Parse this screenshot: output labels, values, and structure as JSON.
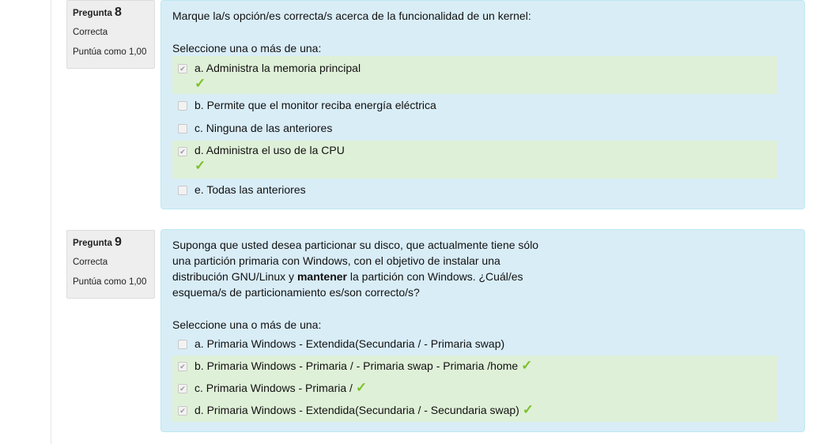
{
  "questions": [
    {
      "label": "Pregunta",
      "number": "8",
      "status": "Correcta",
      "grade": "Puntúa como 1,00",
      "text": "Marque la/s opción/es correcta/s acerca de la funcionalidad de un kernel:",
      "prompt": "Seleccione una o más de una:",
      "options": [
        {
          "text": "a. Administra la memoria principal",
          "checked": true,
          "correct": true
        },
        {
          "text": "b. Permite que el monitor reciba energía eléctrica",
          "checked": false
        },
        {
          "text": "c. Ninguna de las anteriores",
          "checked": false
        },
        {
          "text": "d. Administra el uso de la CPU",
          "checked": true,
          "correct": true
        },
        {
          "text": "e. Todas las anteriores",
          "checked": false
        }
      ]
    },
    {
      "label": "Pregunta",
      "number": "9",
      "status": "Correcta",
      "grade": "Puntúa como 1,00",
      "text_lines": [
        "Suponga que usted desea particionar su disco, que actualmente tiene sólo",
        "una partición primaria con Windows, con el objetivo de instalar una"
      ],
      "text_line3_pre": "distribución GNU/Linux y ",
      "text_line3_bold": "mantener",
      "text_line3_post": " la partición con Windows. ¿Cuál/es",
      "text_line4": "esquema/s de particionamiento es/son correcto/s?",
      "prompt": "Seleccione una o más de una:",
      "options": [
        {
          "text": "a. Primaria Windows - Extendida(Secundaria / - Primaria swap)",
          "checked": false
        },
        {
          "text": "b. Primaria Windows - Primaria / - Primaria swap - Primaria /home",
          "checked": true,
          "correct": true
        },
        {
          "text": "c. Primaria Windows - Primaria /",
          "checked": true,
          "correct": true
        },
        {
          "text": "d. Primaria Windows - Extendida(Secundaria / - Secundaria swap)",
          "checked": true,
          "correct": true
        }
      ]
    }
  ],
  "icons": {
    "check": "✔",
    "correct_tick": "✓"
  },
  "colors": {
    "content_bg": "#d9edf7",
    "correct_bg": "#dff0d8",
    "tick": "#7cc12b"
  }
}
